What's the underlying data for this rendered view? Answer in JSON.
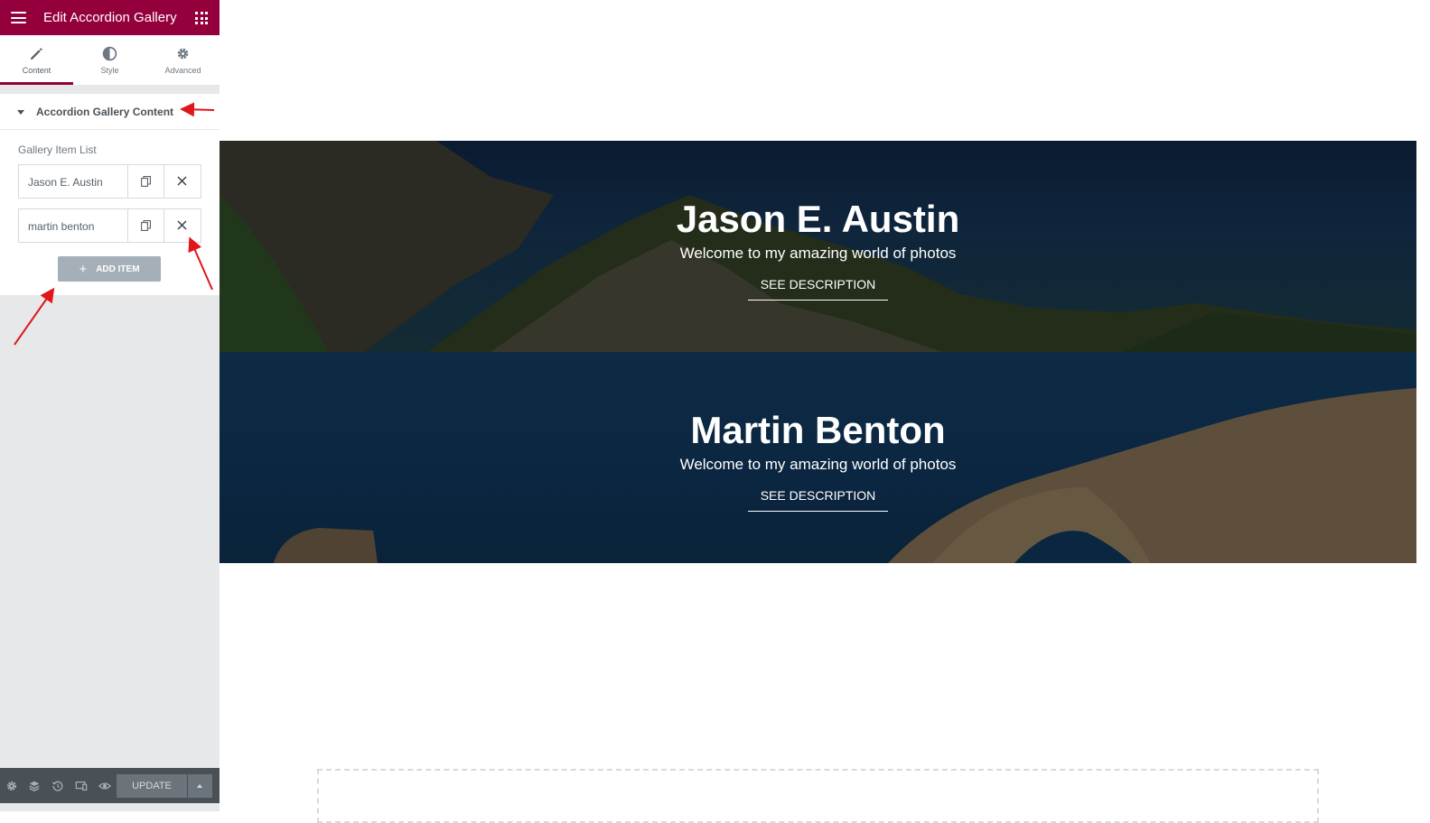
{
  "topbar": {
    "title": "Edit Accordion Gallery"
  },
  "tabs": [
    {
      "label": "Content",
      "active": true
    },
    {
      "label": "Style",
      "active": false
    },
    {
      "label": "Advanced",
      "active": false
    }
  ],
  "section": {
    "title": "Accordion Gallery Content"
  },
  "gallery": {
    "list_label": "Gallery Item List",
    "items": [
      {
        "label": "Jason E. Austin"
      },
      {
        "label": "martin benton"
      }
    ],
    "add_item_label": "ADD ITEM"
  },
  "bottom_bar": {
    "update_label": "UPDATE"
  },
  "accordion": [
    {
      "title": "Jason E. Austin",
      "subtitle": "Welcome to my amazing world of photos",
      "button": "SEE DESCRIPTION"
    },
    {
      "title": "Martin Benton",
      "subtitle": "Welcome to my amazing world of photos",
      "button": "SEE DESCRIPTION"
    }
  ],
  "colors": {
    "brand": "#93003c",
    "annotation_arrow": "#e0161b",
    "sidebar_bg": "#e6e8ea",
    "bottom_bar": "#495157"
  }
}
